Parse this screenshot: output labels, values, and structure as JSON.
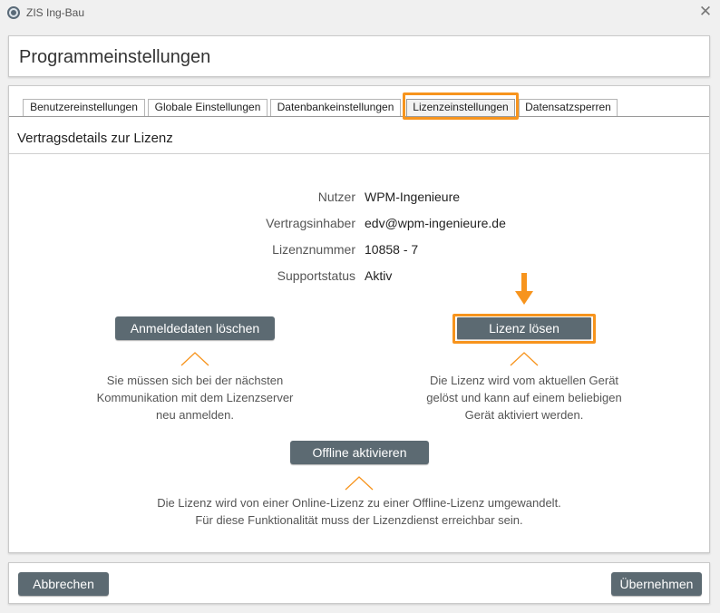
{
  "window": {
    "title": "ZIS Ing-Bau",
    "icon": "app-logo-icon",
    "close_icon": "close-icon"
  },
  "header": {
    "title": "Programmeinstellungen"
  },
  "tabs": [
    {
      "label": "Benutzereinstellungen",
      "active": false
    },
    {
      "label": "Globale Einstellungen",
      "active": false
    },
    {
      "label": "Datenbankeinstellungen",
      "active": false
    },
    {
      "label": "Lizenzeinstellungen",
      "active": true
    },
    {
      "label": "Datensatzsperren",
      "active": false
    }
  ],
  "section": {
    "title": "Vertragsdetails zur Lizenz"
  },
  "details": [
    {
      "label": "Nutzer",
      "value": "WPM-Ingenieure"
    },
    {
      "label": "Vertragsinhaber",
      "value": "edv@wpm-ingenieure.de"
    },
    {
      "label": "Lizenznummer",
      "value": "10858 - 7"
    },
    {
      "label": "Supportstatus",
      "value": "Aktiv"
    }
  ],
  "actions": {
    "clear_login": {
      "label": "Anmeldedaten löschen",
      "note": [
        "Sie müssen sich bei der nächsten",
        "Kommunikation mit dem Lizenzserver",
        "neu anmelden."
      ]
    },
    "release_license": {
      "label": "Lizenz lösen",
      "note": [
        "Die Lizenz wird vom aktuellen Gerät",
        "gelöst und kann auf einem beliebigen",
        "Gerät aktiviert werden."
      ]
    },
    "offline_activate": {
      "label": "Offline aktivieren",
      "note": [
        "Die Lizenz wird von einer Online-Lizenz zu einer Offline-Lizenz umgewandelt.",
        "Für diese Funktionalität muss der Lizenzdienst erreichbar sein."
      ]
    }
  },
  "footer": {
    "cancel_label": "Abbrechen",
    "apply_label": "Übernehmen"
  },
  "colors": {
    "accent": "#f7941d",
    "button": "#5c6a72",
    "button_text": "#ffffff"
  }
}
